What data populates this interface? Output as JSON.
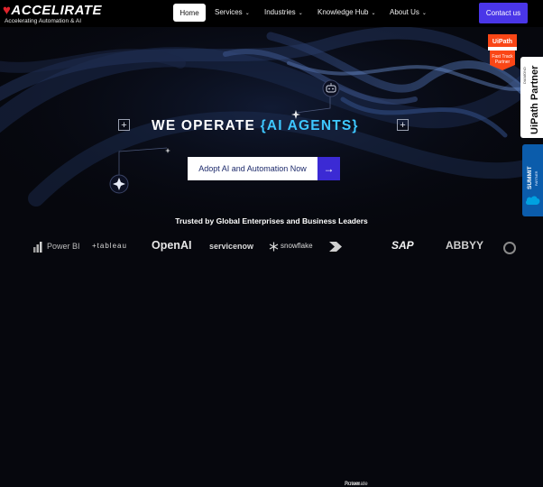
{
  "brand": {
    "name": "ACCELIRATE",
    "tagline": "Accelerating Automation & AI"
  },
  "nav": {
    "home": "Home",
    "items": [
      {
        "label": "Services",
        "caret": "⌄"
      },
      {
        "label": "Industries",
        "caret": "⌄"
      },
      {
        "label": "Knowledge Hub",
        "caret": "⌄"
      },
      {
        "label": "About Us",
        "caret": "⌄"
      }
    ],
    "contact": "Contact us"
  },
  "hero": {
    "headline_prefix": "WE OPERATE",
    "headline_accent": "{AI AGENTS}",
    "cta_label": "Adopt AI and Automation Now",
    "cta_arrow": "→",
    "plus": "+"
  },
  "trusted": "Trusted by Global Enterprises and Business Leaders",
  "logos": {
    "power_bi": "Power BI",
    "tableau": "+tableau",
    "openai": "OpenAI",
    "servicenow": "servicenow",
    "snowflake": "snowflake",
    "power_automate_1": "Power",
    "power_automate_2": "Automate",
    "sap": "SAP",
    "abbyy": "ABBYY"
  },
  "badges": {
    "uipath_logo": "UiPath",
    "uipath_fast_1": "Fast Track",
    "uipath_fast_2": "Partner",
    "diamond_small": "DIAMOND",
    "diamond_big": "UiPath Partner",
    "summit": "SUMMIT",
    "summit_sub": "PARTNER"
  },
  "colors": {
    "accent_cyan": "#3ec7ff",
    "cta_purple": "#3b2ad4",
    "contact_purple": "#4a36e8",
    "brand_red": "#e0242c",
    "uipath_orange": "#fa4616"
  }
}
